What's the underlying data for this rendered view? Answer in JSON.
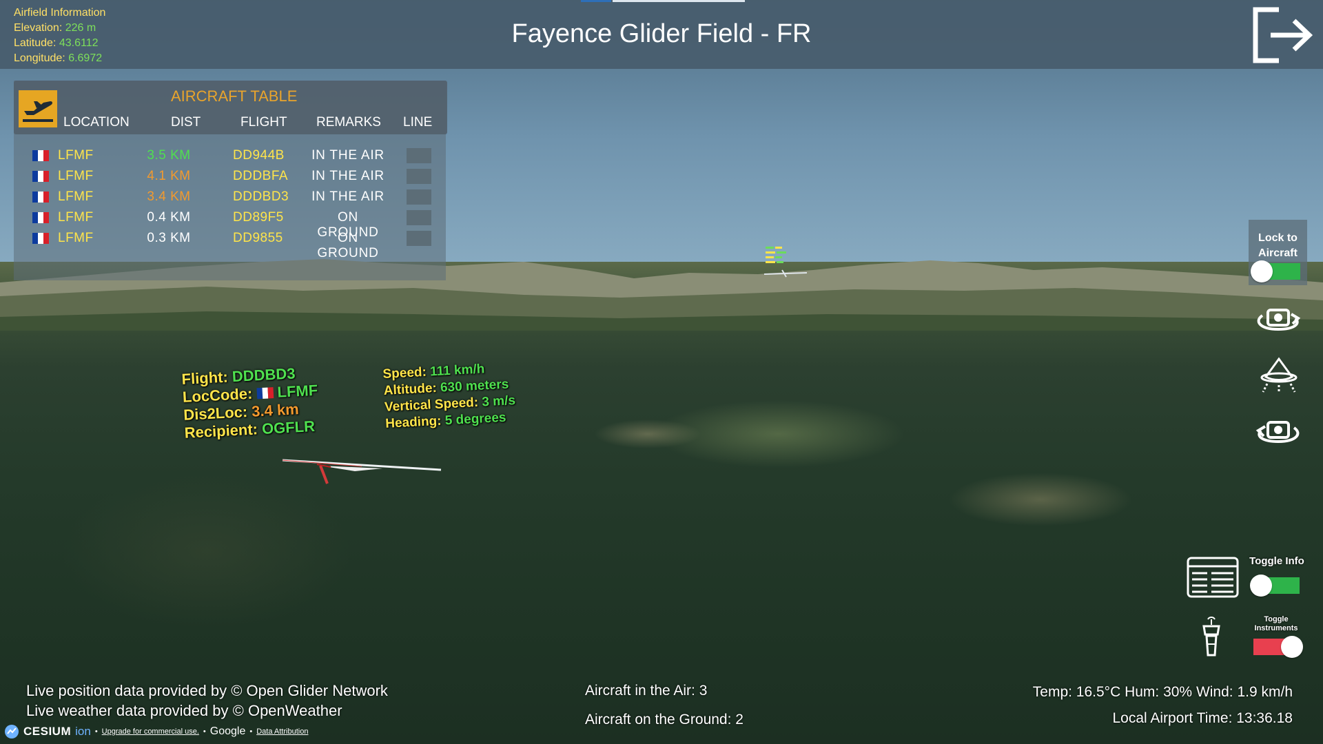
{
  "airfield": {
    "heading": "Airfield Information",
    "elevation_label": "Elevation:",
    "elevation_value": "226 m",
    "latitude_label": "Latitude:",
    "latitude_value": "43.6112",
    "longitude_label": "Longitude:",
    "longitude_value": "6.6972"
  },
  "header": {
    "title": "Fayence Glider Field - FR",
    "exit_icon": "logout-icon"
  },
  "aircraft_table": {
    "title": "AIRCRAFT TABLE",
    "icon": "departure-plane-icon",
    "columns": [
      "LOCATION",
      "DIST",
      "FLIGHT",
      "REMARKS",
      "LINE"
    ],
    "rows": [
      {
        "flag": "france-flag-icon",
        "location": "LFMF",
        "dist": "3.5 KM",
        "dist_color": "#4fe04f",
        "flight": "DD944B",
        "remarks": "IN THE AIR"
      },
      {
        "flag": "france-flag-icon",
        "location": "LFMF",
        "dist": "4.1 KM",
        "dist_color": "#f29a2e",
        "flight": "DDDBFA",
        "remarks": "IN THE AIR"
      },
      {
        "flag": "france-flag-icon",
        "location": "LFMF",
        "dist": "3.4 KM",
        "dist_color": "#f29a2e",
        "flight": "DDDBD3",
        "remarks": "IN THE AIR"
      },
      {
        "flag": "france-flag-icon",
        "location": "LFMF",
        "dist": "0.4 KM",
        "dist_color": "#ffffff",
        "flight": "DD89F5",
        "remarks": "ON GROUND"
      },
      {
        "flag": "france-flag-icon",
        "location": "LFMF",
        "dist": "0.3 KM",
        "dist_color": "#ffffff",
        "flight": "DD9855",
        "remarks": "ON GROUND"
      }
    ]
  },
  "tracked_aircraft": {
    "flight_label": "Flight:",
    "flight_value": "DDDBD3",
    "loccode_label": "LocCode:",
    "loccode_value": "LFMF",
    "dis2loc_label": "Dis2Loc:",
    "dis2loc_value": "3.4 km",
    "recipient_label": "Recipient:",
    "recipient_value": "OGFLR",
    "speed_label": "Speed:",
    "speed_value": "111 km/h",
    "altitude_label": "Altitude:",
    "altitude_value": "630 meters",
    "vspeed_label": "Vertical Speed:",
    "vspeed_value": "3 m/s",
    "heading_label": "Heading:",
    "heading_value": "5 degrees"
  },
  "controls": {
    "lock_label": "Lock to Aircraft",
    "lock_on": true,
    "toggle_info_label": "Toggle Info",
    "toggle_info_on": true,
    "toggle_instruments_label": "Toggle Instruments",
    "toggle_instruments_on": false,
    "icons": [
      "orbit-camera-icon",
      "overhead-view-icon",
      "orbit-camera-reverse-icon",
      "info-table-icon",
      "control-tower-icon"
    ],
    "accent_on": "#2eb34a",
    "accent_off": "#e8404f"
  },
  "footer": {
    "credit_ogn": "Live position data provided by © Open Glider Network",
    "credit_weather": "Live weather data provided by © OpenWeather",
    "in_air": "Aircraft in the Air: 3",
    "on_ground": "Aircraft on the Ground: 2",
    "weather": "Temp: 16.5°C Hum: 30% Wind: 1.9 km/h",
    "local_time": "Local Airport Time: 13:36.18",
    "cesium_brand": "CESIUM",
    "cesium_ion": "ion",
    "upgrade_link": "Upgrade for commercial use.",
    "google": "Google",
    "data_attribution": "Data Attribution"
  }
}
